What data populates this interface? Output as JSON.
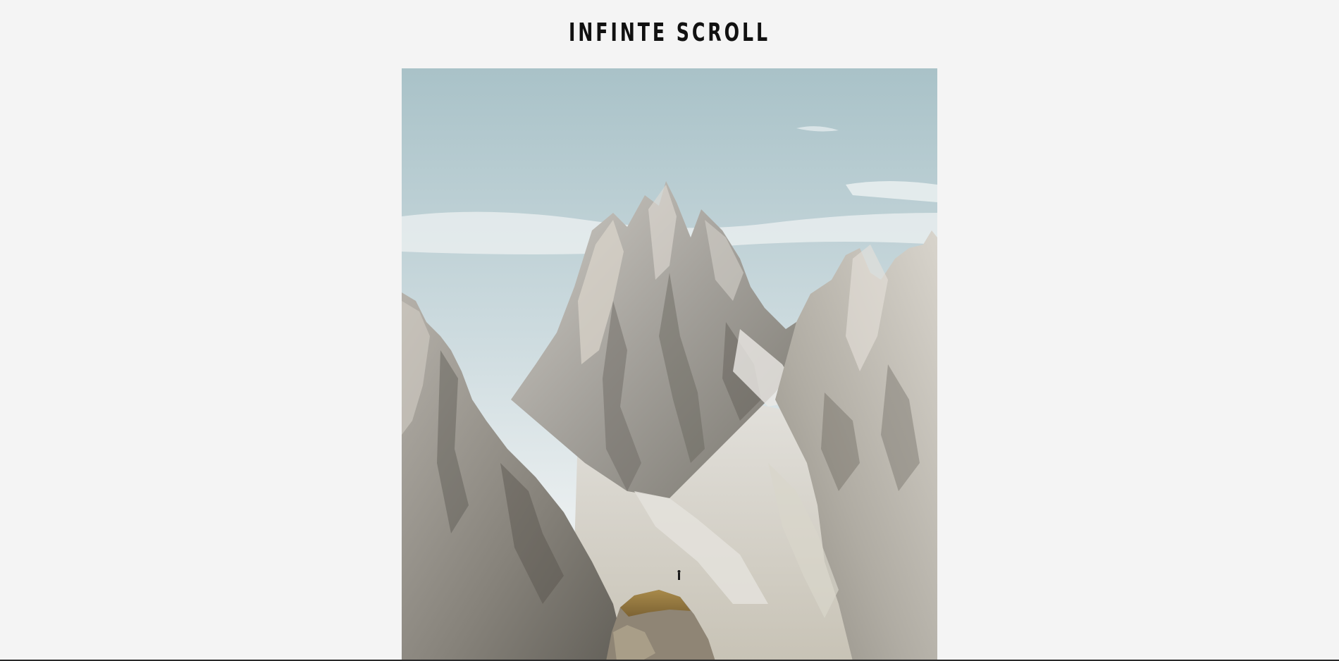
{
  "page": {
    "title": "INFINTE SCROLL"
  },
  "feed": {
    "items": [
      {
        "image": "mountain-landscape-photo"
      }
    ]
  }
}
